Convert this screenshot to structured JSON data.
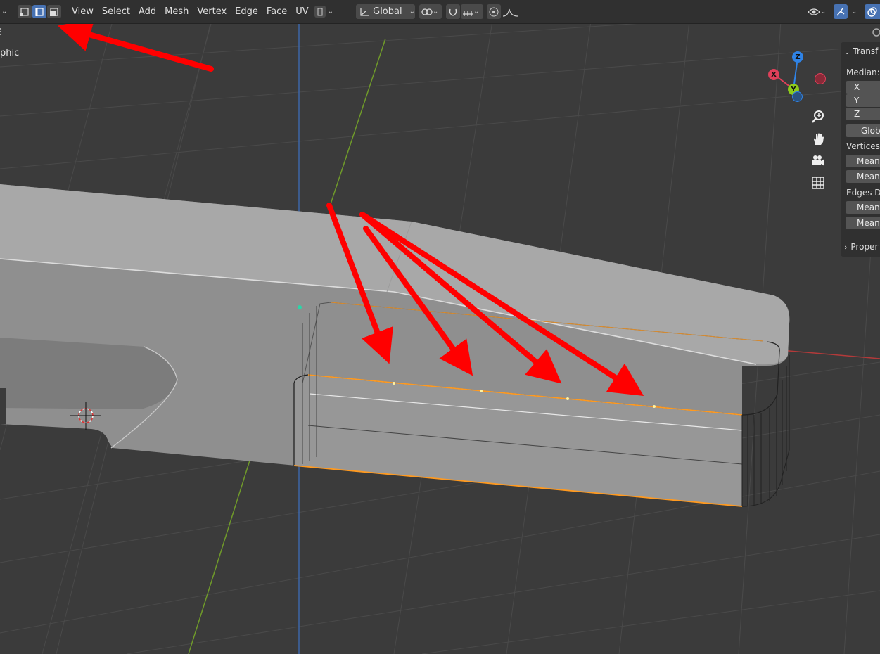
{
  "header": {
    "mode_toggle_icons": [
      "vertex-select-icon",
      "edge-select-icon",
      "face-select-icon"
    ],
    "active_select_mode": "edge",
    "menus": [
      "View",
      "Select",
      "Add",
      "Mesh",
      "Vertex",
      "Edge",
      "Face",
      "UV"
    ],
    "transform_orientation": "Global"
  },
  "viewport": {
    "view_label": "phic"
  },
  "gizmo": {
    "x_label": "X",
    "y_label": "Y",
    "z_label": "Z",
    "colors": {
      "x": "#e0405a",
      "y": "#8dcb1a",
      "z": "#2f83e6"
    }
  },
  "npanel": {
    "transform_header": "Transf",
    "median_label": "Median:",
    "fields": [
      {
        "label": "X"
      },
      {
        "label": "Y"
      },
      {
        "label": "Z"
      }
    ],
    "global_button": "Glob",
    "vertices_label": "Vertices I",
    "vertices_fields": [
      "Mean",
      "Mean"
    ],
    "edges_label": "Edges Da",
    "edges_fields": [
      "Mean",
      "Mean"
    ],
    "properties_header": "Proper"
  },
  "colors": {
    "selection_orange": "#ff9a20",
    "annotation_red": "#ff0000",
    "active_blue": "#4772b3"
  }
}
